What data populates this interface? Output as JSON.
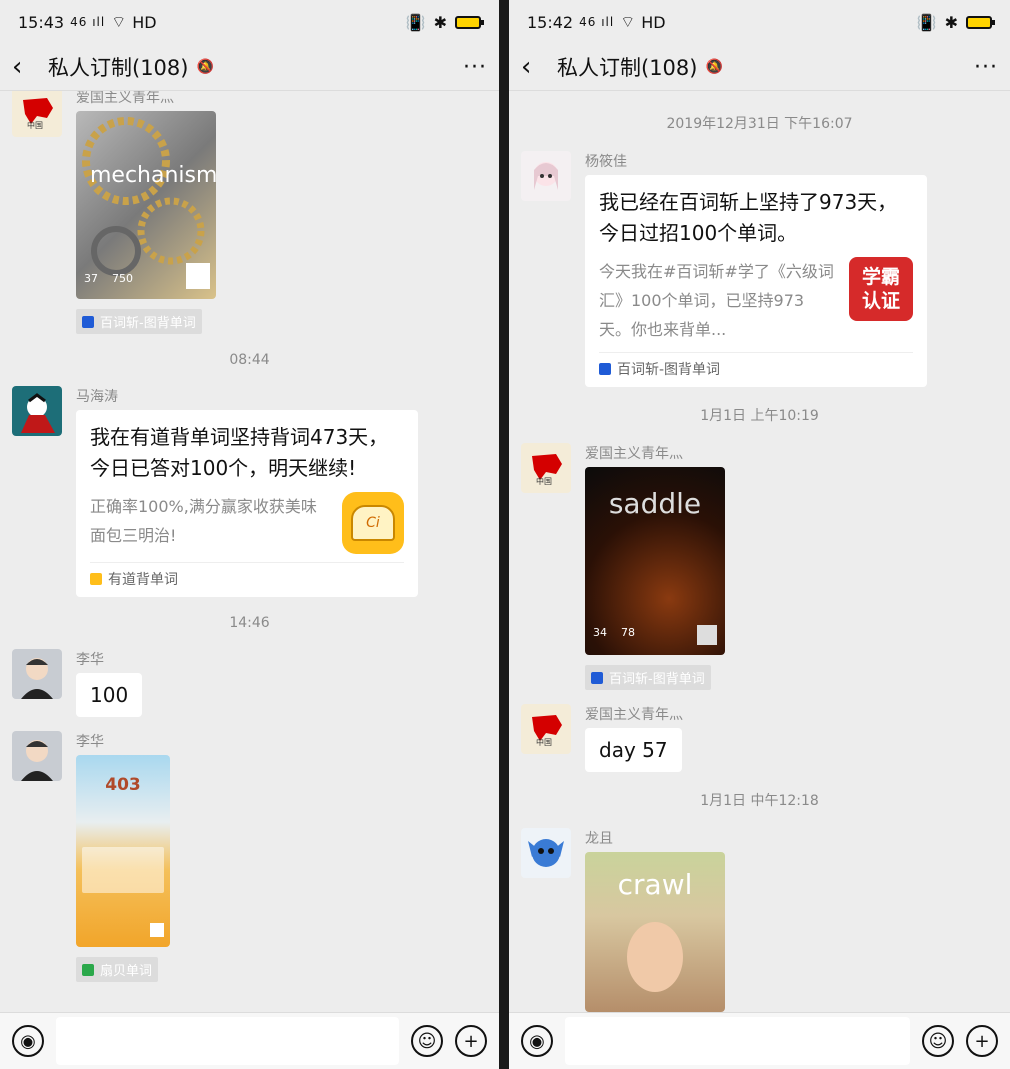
{
  "left": {
    "status": {
      "time": "15:43",
      "signal": "46 ıll",
      "net": "HD"
    },
    "title": "私人订制(108)",
    "messages": {
      "m1_name": "爱国主义青年灬",
      "m1_img_word": "mechanism",
      "m1_img_n1": "37",
      "m1_img_n2": "750",
      "m1_tag": "百词斩-图背单词",
      "ts1": "08:44",
      "m2_name": "马海涛",
      "m2_title": "我在有道背单词坚持背词473天，今日已答对100个，明天继续!",
      "m2_desc": "正确率100%,满分赢家收获美味面包三明治!",
      "m2_src": "有道背单词",
      "ts2": "14:46",
      "m3_name": "李华",
      "m3_text": "100",
      "m4_name": "李华",
      "m4_img_num": "403",
      "m4_tag": "扇贝单词"
    }
  },
  "right": {
    "status": {
      "time": "15:42",
      "signal": "46 ıll",
      "net": "HD"
    },
    "title": "私人订制(108)",
    "messages": {
      "ts0": "2019年12月31日 下午16:07",
      "r1_name": "杨筱佳",
      "r1_title": "我已经在百词斩上坚持了973天，今日过招100个单词。",
      "r1_desc": "今天我在#百词斩#学了《六级词汇》100个单词，已坚持973天。你也来背单...",
      "r1_badge1": "学霸",
      "r1_badge2": "认证",
      "r1_src": "百词斩-图背单词",
      "ts1": "1月1日 上午10:19",
      "r2_name": "爱国主义青年灬",
      "r2_img_word": "saddle",
      "r2_img_n1": "34",
      "r2_img_n2": "78",
      "r2_tag": "百词斩-图背单词",
      "r3_name": "爱国主义青年灬",
      "r3_text": "day 57",
      "ts2": "1月1日 中午12:18",
      "r4_name": "龙且",
      "r4_img_word": "crawl"
    }
  },
  "icons": {
    "back": "‹",
    "mute": "🔕",
    "more": "···",
    "voice": "◉",
    "emoji": "☺",
    "plus": "+"
  }
}
